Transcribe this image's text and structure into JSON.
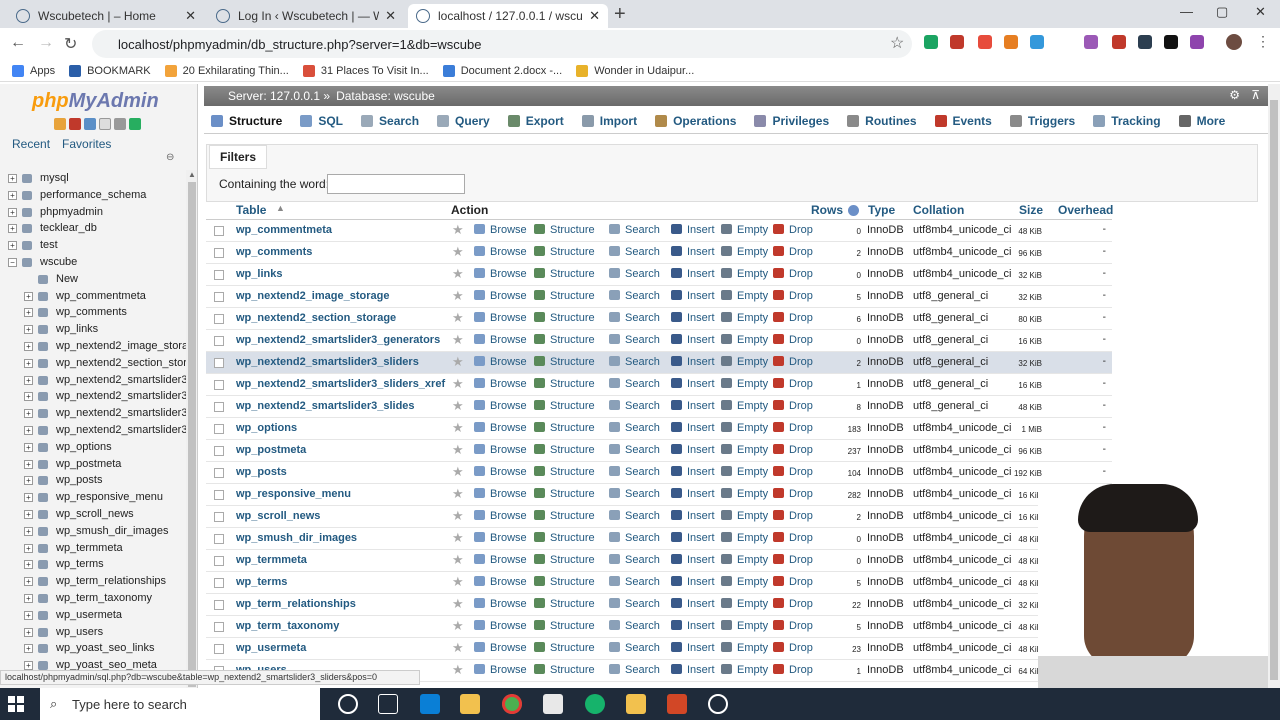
{
  "browser": {
    "tabs": [
      {
        "title": "Wscubetech | – Home",
        "active": false
      },
      {
        "title": "Log In ‹ Wscubetech | — WordPr",
        "active": false
      },
      {
        "title": "localhost / 127.0.0.1 / wscube | p",
        "active": true
      }
    ],
    "url": "localhost/phpmyadmin/db_structure.php?server=1&db=wscube",
    "bookmarks": [
      "Apps",
      "BOOKMARK",
      "20 Exhilarating Thin...",
      "31 Places To Visit In...",
      "Document 2.docx -...",
      "Wonder in Udaipur..."
    ]
  },
  "sidebar": {
    "logo_php": "php",
    "logo_rest": "MyAdmin",
    "tabs": [
      "Recent",
      "Favorites"
    ],
    "tree": [
      {
        "label": "mysql",
        "level": 0,
        "expand": "+"
      },
      {
        "label": "performance_schema",
        "level": 0,
        "expand": "+"
      },
      {
        "label": "phpmyadmin",
        "level": 0,
        "expand": "+"
      },
      {
        "label": "tecklear_db",
        "level": 0,
        "expand": "+"
      },
      {
        "label": "test",
        "level": 0,
        "expand": "+"
      },
      {
        "label": "wscube",
        "level": 0,
        "expand": "−"
      },
      {
        "label": "New",
        "level": 1,
        "expand": ""
      },
      {
        "label": "wp_commentmeta",
        "level": 1,
        "expand": "+"
      },
      {
        "label": "wp_comments",
        "level": 1,
        "expand": "+"
      },
      {
        "label": "wp_links",
        "level": 1,
        "expand": "+"
      },
      {
        "label": "wp_nextend2_image_stora",
        "level": 1,
        "expand": "+"
      },
      {
        "label": "wp_nextend2_section_stor",
        "level": 1,
        "expand": "+"
      },
      {
        "label": "wp_nextend2_smartslider3",
        "level": 1,
        "expand": "+"
      },
      {
        "label": "wp_nextend2_smartslider3",
        "level": 1,
        "expand": "+"
      },
      {
        "label": "wp_nextend2_smartslider3",
        "level": 1,
        "expand": "+"
      },
      {
        "label": "wp_nextend2_smartslider3",
        "level": 1,
        "expand": "+"
      },
      {
        "label": "wp_options",
        "level": 1,
        "expand": "+"
      },
      {
        "label": "wp_postmeta",
        "level": 1,
        "expand": "+"
      },
      {
        "label": "wp_posts",
        "level": 1,
        "expand": "+"
      },
      {
        "label": "wp_responsive_menu",
        "level": 1,
        "expand": "+"
      },
      {
        "label": "wp_scroll_news",
        "level": 1,
        "expand": "+"
      },
      {
        "label": "wp_smush_dir_images",
        "level": 1,
        "expand": "+"
      },
      {
        "label": "wp_termmeta",
        "level": 1,
        "expand": "+"
      },
      {
        "label": "wp_terms",
        "level": 1,
        "expand": "+"
      },
      {
        "label": "wp_term_relationships",
        "level": 1,
        "expand": "+"
      },
      {
        "label": "wp_term_taxonomy",
        "level": 1,
        "expand": "+"
      },
      {
        "label": "wp_usermeta",
        "level": 1,
        "expand": "+"
      },
      {
        "label": "wp_users",
        "level": 1,
        "expand": "+"
      },
      {
        "label": "wp_yoast_seo_links",
        "level": 1,
        "expand": "+"
      },
      {
        "label": "wp_yoast_seo_meta",
        "level": 1,
        "expand": "+"
      }
    ]
  },
  "main": {
    "breadcrumb": {
      "server": "Server: 127.0.0.1 »",
      "database": "Database: wscube"
    },
    "menu_tabs": [
      "Structure",
      "SQL",
      "Search",
      "Query",
      "Export",
      "Import",
      "Operations",
      "Privileges",
      "Routines",
      "Events",
      "Triggers",
      "Tracking",
      "More"
    ],
    "filters": {
      "title": "Filters",
      "label": "Containing the word:",
      "value": ""
    },
    "columns": {
      "table": "Table",
      "action": "Action",
      "rows": "Rows",
      "type": "Type",
      "collation": "Collation",
      "size": "Size",
      "overhead": "Overhead"
    },
    "actions": [
      "Browse",
      "Structure",
      "Search",
      "Insert",
      "Empty",
      "Drop"
    ],
    "tables": [
      {
        "name": "wp_commentmeta",
        "rows": "0",
        "type": "InnoDB",
        "collation": "utf8mb4_unicode_ci",
        "size": "48 KiB",
        "overhead": "-"
      },
      {
        "name": "wp_comments",
        "rows": "2",
        "type": "InnoDB",
        "collation": "utf8mb4_unicode_ci",
        "size": "96 KiB",
        "overhead": "-"
      },
      {
        "name": "wp_links",
        "rows": "0",
        "type": "InnoDB",
        "collation": "utf8mb4_unicode_ci",
        "size": "32 KiB",
        "overhead": "-"
      },
      {
        "name": "wp_nextend2_image_storage",
        "rows": "5",
        "type": "InnoDB",
        "collation": "utf8_general_ci",
        "size": "32 KiB",
        "overhead": "-"
      },
      {
        "name": "wp_nextend2_section_storage",
        "rows": "6",
        "type": "InnoDB",
        "collation": "utf8_general_ci",
        "size": "80 KiB",
        "overhead": "-"
      },
      {
        "name": "wp_nextend2_smartslider3_generators",
        "rows": "0",
        "type": "InnoDB",
        "collation": "utf8_general_ci",
        "size": "16 KiB",
        "overhead": "-"
      },
      {
        "name": "wp_nextend2_smartslider3_sliders",
        "rows": "2",
        "type": "InnoDB",
        "collation": "utf8_general_ci",
        "size": "32 KiB",
        "overhead": "-"
      },
      {
        "name": "wp_nextend2_smartslider3_sliders_xref",
        "rows": "1",
        "type": "InnoDB",
        "collation": "utf8_general_ci",
        "size": "16 KiB",
        "overhead": "-"
      },
      {
        "name": "wp_nextend2_smartslider3_slides",
        "rows": "8",
        "type": "InnoDB",
        "collation": "utf8_general_ci",
        "size": "48 KiB",
        "overhead": "-"
      },
      {
        "name": "wp_options",
        "rows": "183",
        "type": "InnoDB",
        "collation": "utf8mb4_unicode_ci",
        "size": "1 MiB",
        "overhead": "-"
      },
      {
        "name": "wp_postmeta",
        "rows": "237",
        "type": "InnoDB",
        "collation": "utf8mb4_unicode_ci",
        "size": "96 KiB",
        "overhead": "-"
      },
      {
        "name": "wp_posts",
        "rows": "104",
        "type": "InnoDB",
        "collation": "utf8mb4_unicode_ci",
        "size": "192 KiB",
        "overhead": "-"
      },
      {
        "name": "wp_responsive_menu",
        "rows": "282",
        "type": "InnoDB",
        "collation": "utf8mb4_unicode_ci",
        "size": "16 KiB",
        "overhead": "-"
      },
      {
        "name": "wp_scroll_news",
        "rows": "2",
        "type": "InnoDB",
        "collation": "utf8mb4_unicode_ci",
        "size": "16 KiB",
        "overhead": "-"
      },
      {
        "name": "wp_smush_dir_images",
        "rows": "0",
        "type": "InnoDB",
        "collation": "utf8mb4_unicode_ci",
        "size": "48 KiB",
        "overhead": "-"
      },
      {
        "name": "wp_termmeta",
        "rows": "0",
        "type": "InnoDB",
        "collation": "utf8mb4_unicode_ci",
        "size": "48 KiB",
        "overhead": "-"
      },
      {
        "name": "wp_terms",
        "rows": "5",
        "type": "InnoDB",
        "collation": "utf8mb4_unicode_ci",
        "size": "48 KiB",
        "overhead": "-"
      },
      {
        "name": "wp_term_relationships",
        "rows": "22",
        "type": "InnoDB",
        "collation": "utf8mb4_unicode_ci",
        "size": "32 KiB",
        "overhead": "-"
      },
      {
        "name": "wp_term_taxonomy",
        "rows": "5",
        "type": "InnoDB",
        "collation": "utf8mb4_unicode_ci",
        "size": "48 KiB",
        "overhead": "-"
      },
      {
        "name": "wp_usermeta",
        "rows": "23",
        "type": "InnoDB",
        "collation": "utf8mb4_unicode_ci",
        "size": "48 KiB",
        "overhead": "-"
      },
      {
        "name": "wp_users",
        "rows": "1",
        "type": "InnoDB",
        "collation": "utf8mb4_unicode_ci",
        "size": "64 KiB",
        "overhead": "-"
      }
    ],
    "hovered_row": 6
  },
  "status_url": "localhost/phpmyadmin/sql.php?db=wscube&table=wp_nextend2_smartslider3_sliders&pos=0",
  "taskbar": {
    "search_placeholder": "Type here to search"
  },
  "colors": {
    "link": "#235a81",
    "accent": "#f89c0e",
    "taskbar": "#1f2b3a"
  }
}
